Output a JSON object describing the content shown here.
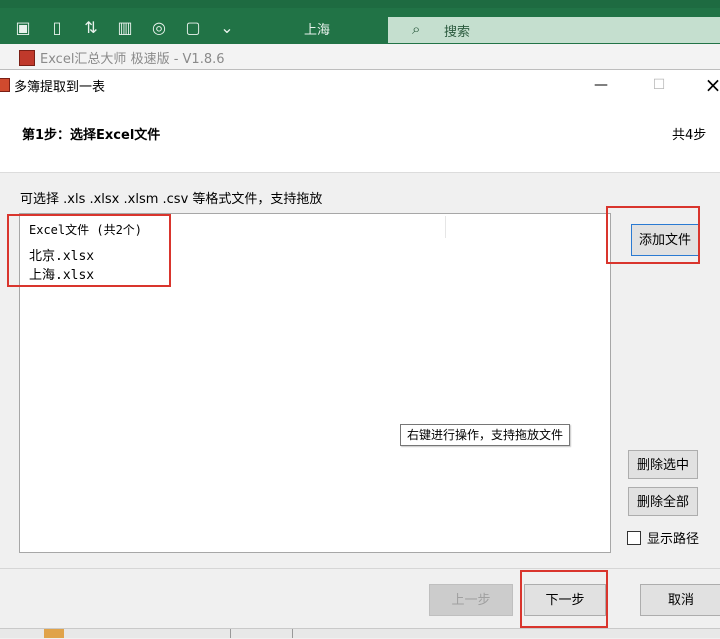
{
  "excel_ribbon": {
    "city": "上海",
    "search_label": "搜索",
    "icons": [
      "save-icon",
      "new-doc-icon",
      "sort-icon",
      "chart-icon",
      "shapes-icon",
      "textbox-icon",
      "more-icon"
    ]
  },
  "app_window": {
    "title": "Excel汇总大师 极速版 - V1.8.6"
  },
  "dialog": {
    "title": "多簿提取到一表",
    "step_label": "第1步：选择Excel文件",
    "step_total": "共4步",
    "hint": "可选择 .xls  .xlsx  .xlsm .csv 等格式文件，支持拖放",
    "list": {
      "header": "Excel文件 (共2个)",
      "items": [
        "北京.xlsx",
        "上海.xlsx"
      ],
      "tooltip": "右键进行操作，支持拖放文件"
    },
    "buttons": {
      "add_file": "添加文件",
      "delete_selected": "删除选中",
      "delete_all": "删除全部",
      "show_path": "显示路径",
      "prev": "上一步",
      "next": "下一步",
      "cancel": "取消"
    },
    "show_path_checked": false,
    "highlight_color": "#d9352d"
  }
}
